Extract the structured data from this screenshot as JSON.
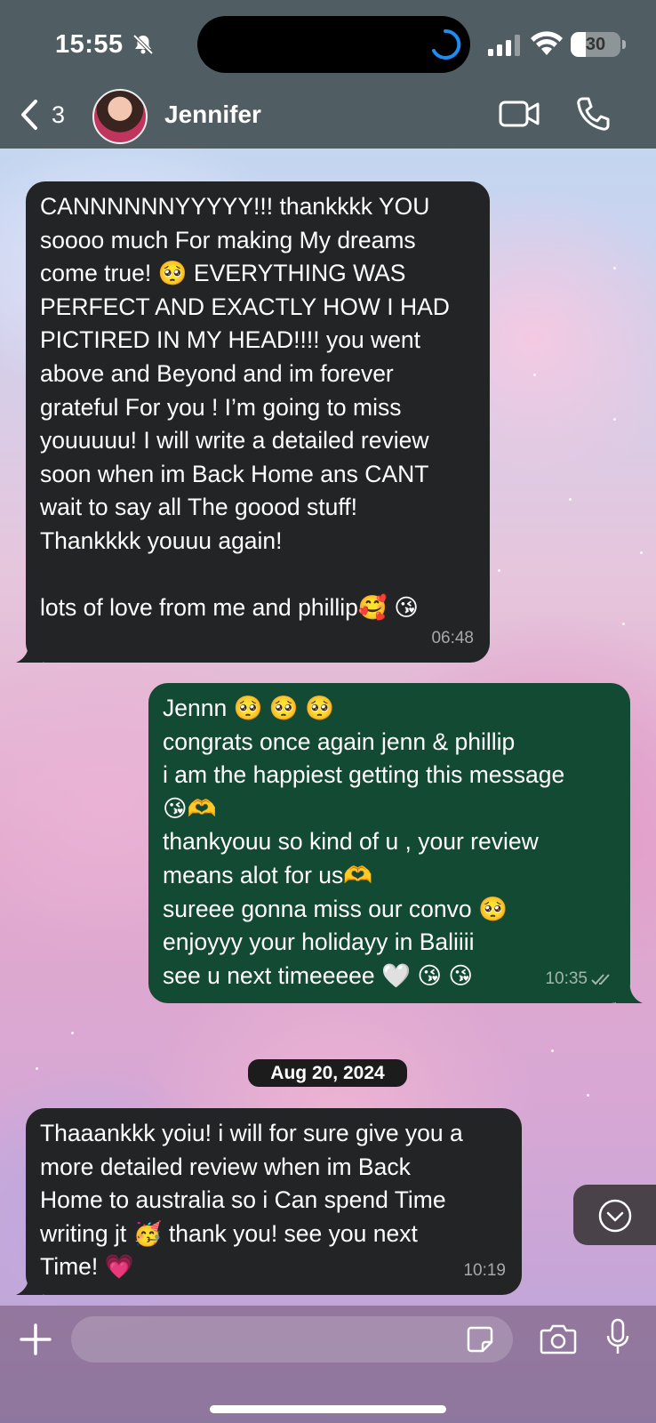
{
  "status_bar": {
    "time": "15:55",
    "battery_level": "30",
    "battery_fraction": 0.3
  },
  "header": {
    "back_count": "3",
    "contact_name": "Jennifer"
  },
  "messages": [
    {
      "direction": "incoming",
      "text": "CANNNNNNYYYYY!!! thankkkk YOU\nsoooo much For making My dreams\ncome true! 🥺 EVERYTHING WAS\nPERFECT AND EXACTLY HOW I HAD\nPICTIRED IN MY HEAD!!!! you went\nabove and Beyond and im forever\ngrateful For you ! I’m going to miss\nyouuuuu! I will write a detailed review\nsoon when im Back Home ans CANT\nwait to say all The goood stuff!\nThankkkk youuu again!\n\nlots of love from me and phillip🥰 😘",
      "time": "06:48"
    },
    {
      "direction": "outgoing",
      "text": "Jennn 🥺 🥺 🥺\ncongrats once again jenn & phillip\ni am the happiest getting this message\n😘🫶\nthankyouu so kind of u , your review\nmeans alot for us🫶\nsureee gonna miss our convo 🥺\nenjoyyy your holidayy in Baliiii\nsee u next timeeeee 🤍 😘 😘",
      "time": "10:35",
      "status": "read"
    },
    {
      "direction": "incoming",
      "text": "Thaaankkk yoiu! i will for sure give you a\nmore detailed review when im Back\nHome to australia so i Can spend Time\nwriting jt 🥳 thank you! see you next\nTime! 💗",
      "time": "10:19"
    }
  ],
  "date_separator": "Aug 20, 2024",
  "composer": {
    "placeholder": ""
  },
  "colors": {
    "incoming_bubble": "#232425",
    "outgoing_bubble": "#124a33",
    "header_bg": "#465256"
  },
  "icons": [
    "bell-slash-icon",
    "spinner-icon",
    "signal-icon",
    "wifi-icon",
    "back-chevron-icon",
    "video-call-icon",
    "phone-icon",
    "scroll-down-icon",
    "plus-icon",
    "sticker-icon",
    "camera-icon",
    "microphone-icon",
    "double-check-icon"
  ]
}
